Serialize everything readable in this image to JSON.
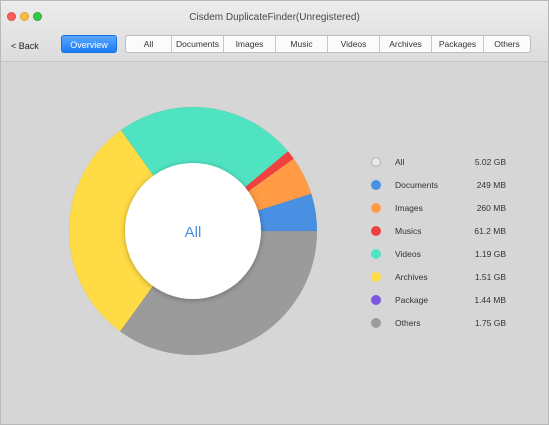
{
  "window": {
    "title": "Cisdem DuplicateFinder(Unregistered)"
  },
  "toolbar": {
    "back_label": "< Back",
    "overview_label": "Overview",
    "tabs": [
      "All",
      "Documents",
      "Images",
      "Music",
      "Videos",
      "Archives",
      "Packages",
      "Others"
    ]
  },
  "donut": {
    "center_label": "All",
    "center_color": "#4a90d9"
  },
  "legend": [
    {
      "name": "All",
      "value": "5.02 GB",
      "color": "#e6e6e6"
    },
    {
      "name": "Documents",
      "value": "249 MB",
      "color": "#4a90e2"
    },
    {
      "name": "Images",
      "value": "260 MB",
      "color": "#ff9a45"
    },
    {
      "name": "Musics",
      "value": "61.2 MB",
      "color": "#f0413f"
    },
    {
      "name": "Videos",
      "value": "1.19 GB",
      "color": "#50e3c2"
    },
    {
      "name": "Archives",
      "value": "1.51 GB",
      "color": "#ffdc45"
    },
    {
      "name": "Package",
      "value": "1.44 MB",
      "color": "#7f56e3"
    },
    {
      "name": "Others",
      "value": "1.75 GB",
      "color": "#9b9b9b"
    }
  ],
  "chart_data": {
    "type": "pie",
    "unit": "MB",
    "categories": [
      "Documents",
      "Images",
      "Musics",
      "Videos",
      "Archives",
      "Package",
      "Others"
    ],
    "values": [
      249,
      260,
      61.2,
      1218.6,
      1546.2,
      1.44,
      1792
    ],
    "colors": [
      "#4a90e2",
      "#ff9a45",
      "#f0413f",
      "#50e3c2",
      "#ffdc45",
      "#7f56e3",
      "#9b9b9b"
    ]
  }
}
